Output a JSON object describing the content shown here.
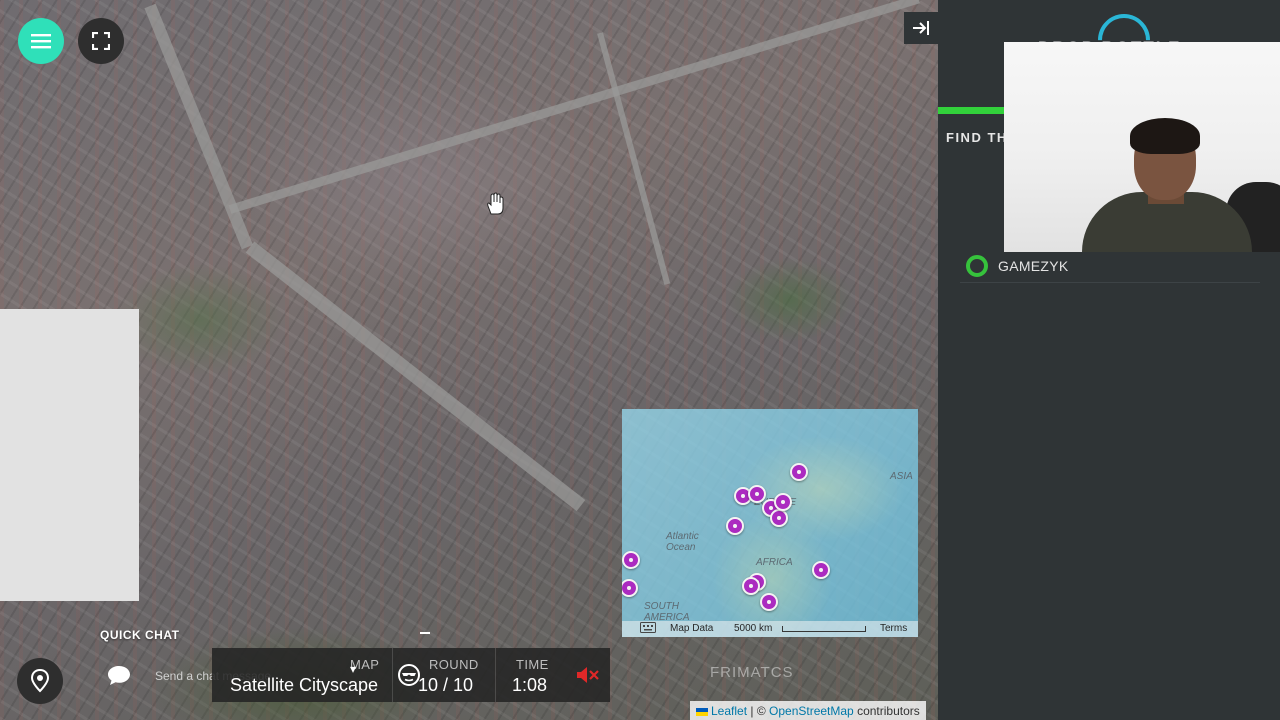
{
  "map": {
    "minimap": {
      "labels": [
        "ASIA",
        "EUROPE",
        "AFRICA",
        "Atlantic Ocean",
        "SOUTH AMERICA"
      ],
      "keyboard_label": "Map Data",
      "scale_label": "5000 km",
      "terms_label": "Terms",
      "icon": "keyboard-icon"
    },
    "attribution": {
      "leaflet": "Leaflet",
      "separator": "| ©",
      "osm": "OpenStreetMap",
      "contributors": "contributors"
    }
  },
  "controls": {
    "menu_icon": "hamburger-menu-icon",
    "fullscreen_icon": "fullscreen-icon",
    "collapse_icon": "collapse-sidebar-icon",
    "accent_color": "#2fe0b9"
  },
  "chat": {
    "title": "QUICK CHAT",
    "placeholder": "Send a chat message"
  },
  "hud": {
    "map_label": "MAP",
    "map_value": "Satellite Cityscape",
    "round_label": "ROUND",
    "round_value": "10 / 10",
    "time_label": "TIME",
    "time_value": "1:08",
    "ghost_text": "FRIMATCS"
  },
  "sidebar": {
    "logo_text": "DROP BOTTLE",
    "progress_color": "#32d13b",
    "find_title": "FIND TH",
    "players": [
      {
        "name": "GAMEZYK",
        "status_color": "#36c23c"
      }
    ]
  }
}
